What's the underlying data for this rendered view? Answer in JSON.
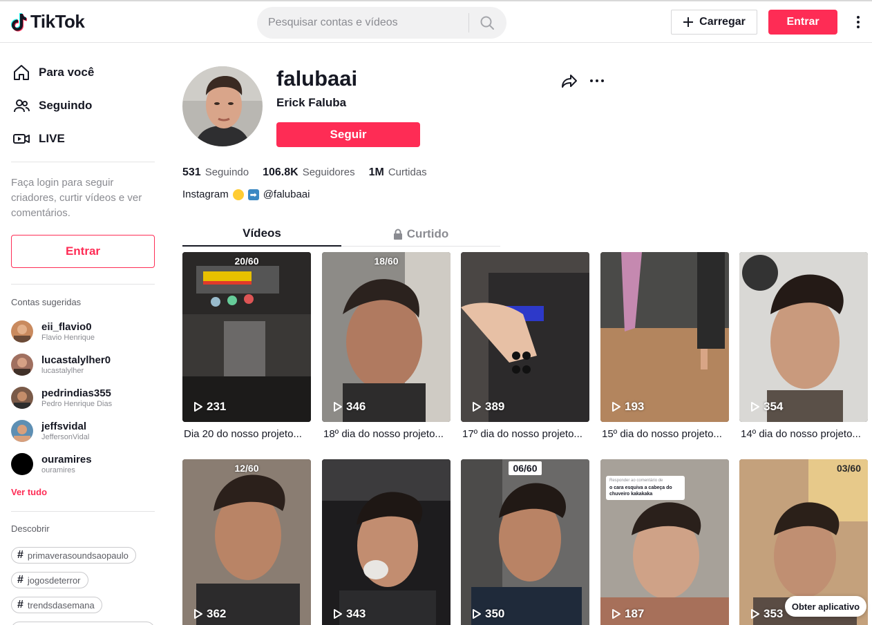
{
  "header": {
    "logo_text": "TikTok",
    "search_placeholder": "Pesquisar contas e vídeos",
    "upload_label": "Carregar",
    "login_label": "Entrar"
  },
  "sidebar": {
    "nav": [
      {
        "label": "Para você",
        "icon": "home-icon"
      },
      {
        "label": "Seguindo",
        "icon": "users-icon"
      },
      {
        "label": "LIVE",
        "icon": "live-icon"
      }
    ],
    "login_hint": "Faça login para seguir criadores, curtir vídeos e ver comentários.",
    "login_button": "Entrar",
    "suggested_title": "Contas sugeridas",
    "suggested": [
      {
        "username": "eii_flavio0",
        "nickname": "Flavio Henrique"
      },
      {
        "username": "lucastalylher0",
        "nickname": "lucastalylher"
      },
      {
        "username": "pedrindias355",
        "nickname": "Pedro Henrique Dias"
      },
      {
        "username": "jeffsvidal",
        "nickname": "JeffersonVidal"
      },
      {
        "username": "ouramires",
        "nickname": "ouramires"
      }
    ],
    "see_all": "Ver tudo",
    "discover_title": "Descobrir",
    "tags": [
      "primaverasoundsaopaulo",
      "jogosdeterror",
      "trendsdasemana"
    ]
  },
  "profile": {
    "handle": "falubaai",
    "display_name": "Erick Faluba",
    "follow_label": "Seguir",
    "stats": {
      "following_count": "531",
      "following_label": "Seguindo",
      "followers_count": "106.8K",
      "followers_label": "Seguidores",
      "likes_count": "1M",
      "likes_label": "Curtidas"
    },
    "bio_prefix": "Instagram",
    "bio_handle": "@falubaai"
  },
  "tabs": {
    "videos": "Vídeos",
    "liked": "Curtido"
  },
  "videos": [
    {
      "views": "231",
      "caption": "Dia 20 do nosso projeto...",
      "counter": "20/60",
      "counter_style": "plain"
    },
    {
      "views": "346",
      "caption": "18º dia do nosso projeto...",
      "counter": "18/60",
      "counter_style": "plain"
    },
    {
      "views": "389",
      "caption": "17º dia do nosso projeto...",
      "counter": "",
      "counter_style": "none"
    },
    {
      "views": "193",
      "caption": "15º dia do nosso projeto...",
      "counter": "",
      "counter_style": "none"
    },
    {
      "views": "354",
      "caption": "14º dia do nosso projeto...",
      "counter": "",
      "counter_style": "none"
    },
    {
      "views": "362",
      "caption": "",
      "counter": "12/60",
      "counter_style": "plain"
    },
    {
      "views": "343",
      "caption": "",
      "counter": "",
      "counter_style": "none"
    },
    {
      "views": "350",
      "caption": "",
      "counter": "06/60",
      "counter_style": "boxed"
    },
    {
      "views": "187",
      "caption": "",
      "counter": "",
      "counter_style": "none",
      "overlay_text": "o cara esquiva a cabeça do chuveiro kakakaka",
      "overlay_sub": "Responder ao comentário de"
    },
    {
      "views": "353",
      "caption": "",
      "counter": "03/60",
      "counter_style": "plain"
    }
  ],
  "get_app_label": "Obter aplicativo",
  "colors": {
    "brand": "#fe2c55",
    "text": "#161823",
    "muted": "#8a8b91"
  }
}
